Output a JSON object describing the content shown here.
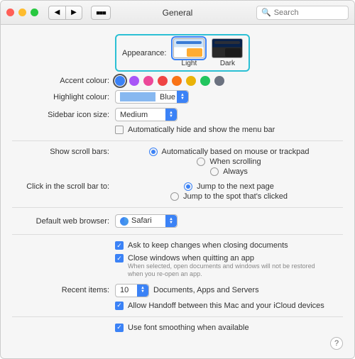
{
  "window": {
    "title": "General"
  },
  "search": {
    "placeholder": "Search"
  },
  "section1": {
    "appearance": {
      "label": "Appearance:",
      "light": "Light",
      "dark": "Dark",
      "selected": "light"
    },
    "accent": {
      "label": "Accent colour:",
      "colors": [
        "#3b82f6",
        "#a855f7",
        "#ec4899",
        "#ef4444",
        "#f97316",
        "#eab308",
        "#22c55e",
        "#6b7280"
      ],
      "selected": 0
    },
    "highlight": {
      "label": "Highlight colour:",
      "value": "Blue"
    },
    "sidebar": {
      "label": "Sidebar icon size:",
      "value": "Medium"
    },
    "autohide": {
      "label": "Automatically hide and show the menu bar",
      "checked": false
    }
  },
  "section2": {
    "scroll": {
      "label": "Show scroll bars:",
      "options": [
        "Automatically based on mouse or trackpad",
        "When scrolling",
        "Always"
      ],
      "selected": 0
    },
    "click": {
      "label": "Click in the scroll bar to:",
      "options": [
        "Jump to the next page",
        "Jump to the spot that's clicked"
      ],
      "selected": 0
    }
  },
  "section3": {
    "browser": {
      "label": "Default web browser:",
      "value": "Safari"
    }
  },
  "section4": {
    "ask": {
      "label": "Ask to keep changes when closing documents",
      "checked": true
    },
    "close": {
      "label": "Close windows when quitting an app",
      "checked": true
    },
    "close_hint": "When selected, open documents and windows will not be restored when you re-open an app.",
    "recent": {
      "label": "Recent items:",
      "value": "10",
      "suffix": "Documents, Apps and Servers"
    },
    "handoff": {
      "label": "Allow Handoff between this Mac and your iCloud devices",
      "checked": true
    }
  },
  "section5": {
    "smoothing": {
      "label": "Use font smoothing when available",
      "checked": true
    }
  }
}
